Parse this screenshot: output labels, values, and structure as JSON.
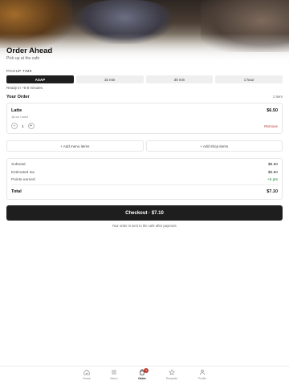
{
  "hero": {
    "title": "Order Ahead",
    "subtitle": "Pick up at the cafe"
  },
  "pickup": {
    "label": "PICKUP TIME",
    "options": [
      "ASAP",
      "15 min",
      "30 min",
      "1 hour"
    ],
    "selected": "ASAP",
    "ready_text": "Ready in ~5-8 minutes"
  },
  "order": {
    "heading": "Your Order",
    "count": "1 item",
    "item": {
      "name": "Latte",
      "options": "16 oz / Iced",
      "price": "$6.50",
      "qty": "1",
      "remove_label": "Remove"
    }
  },
  "add": {
    "menu_label": "+ Add menu items",
    "shop_label": "+ Add shop items"
  },
  "summary": {
    "subtotal_label": "Subtotal",
    "subtotal": "$6.50",
    "tax_label": "Estimated tax",
    "tax": "$0.60",
    "points_label": "Points earned",
    "points": "+6 pts",
    "total_label": "Total",
    "total": "$7.10"
  },
  "checkout": {
    "label": "Checkout · $7.10",
    "note": "Your order is sent to the cafe after payment."
  },
  "tabbar": {
    "tabs": [
      "Home",
      "Menu",
      "Order",
      "Rewards",
      "Profile"
    ],
    "active": "Order",
    "order_badge": "1"
  },
  "colors": {
    "primary": "#1e1e1e",
    "accent": "#c0392b",
    "points": "#1f8a3a"
  },
  "icons": [
    "home-icon",
    "menu-icon",
    "bag-icon",
    "star-icon",
    "person-icon"
  ]
}
